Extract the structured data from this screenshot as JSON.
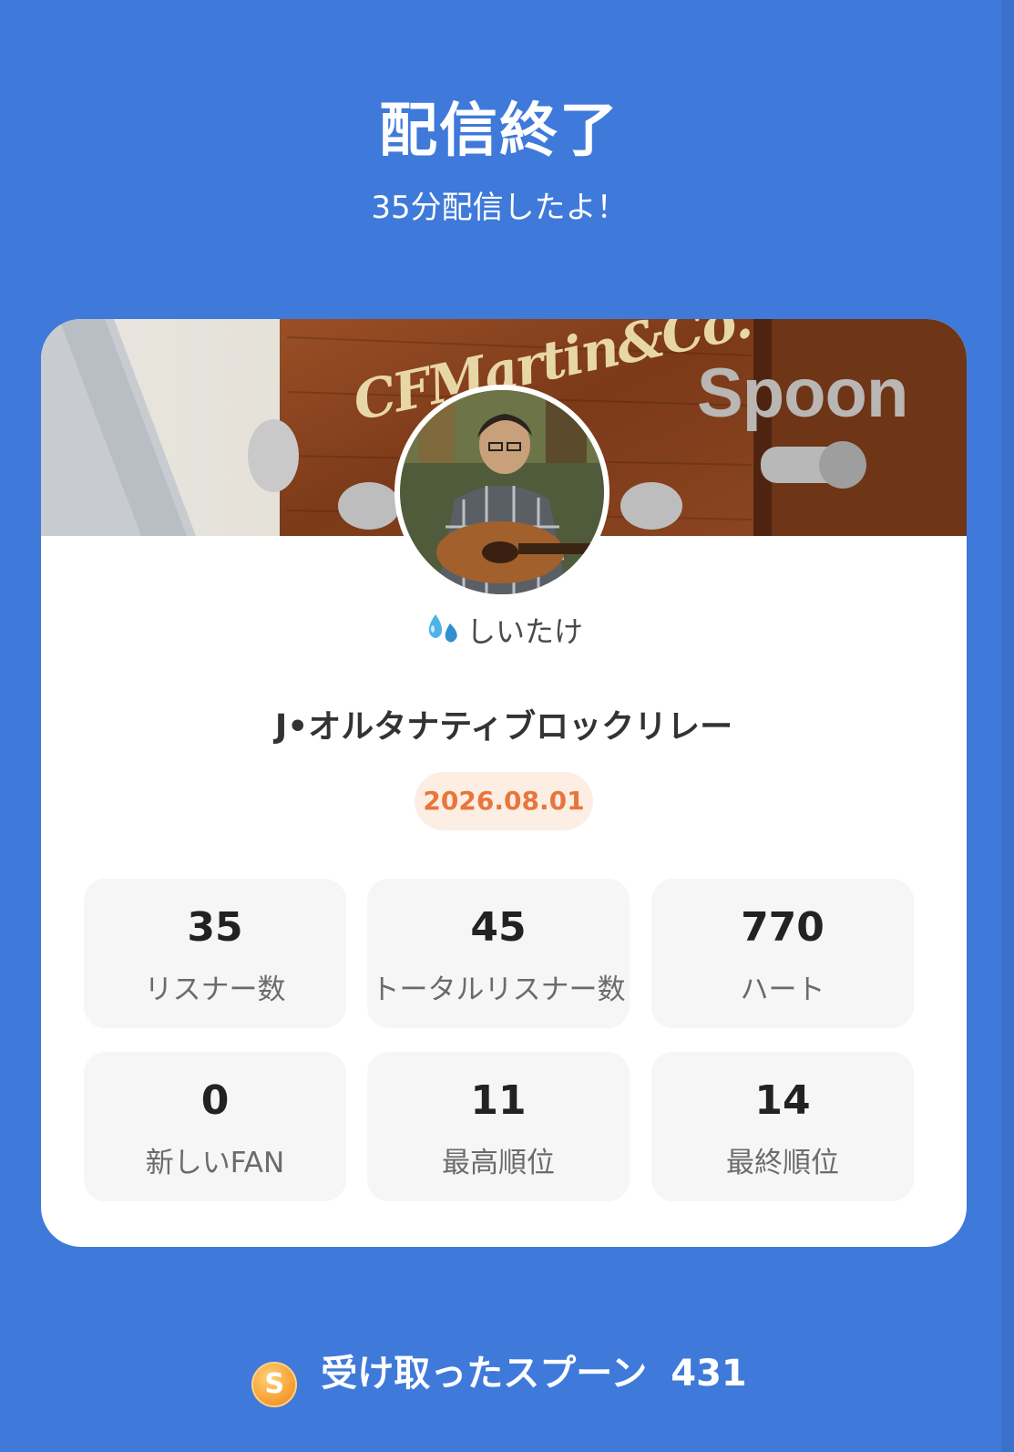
{
  "header": {
    "title": "配信終了",
    "subtitle": "35分配信したよ！"
  },
  "card": {
    "banner_watermark": "Spoon",
    "banner_brand_text": "CFMartin&Co.",
    "username": "しいたけ",
    "username_emoji": "sweat-droplets-icon",
    "live_title": "J•オルタナティブロックリレー",
    "date": "2026.08.01"
  },
  "stats": [
    {
      "value": "35",
      "label": "リスナー数"
    },
    {
      "value": "45",
      "label": "トータルリスナー数"
    },
    {
      "value": "770",
      "label": "ハート"
    },
    {
      "value": "0",
      "label": "新しいFAN"
    },
    {
      "value": "11",
      "label": "最高順位"
    },
    {
      "value": "14",
      "label": "最終順位"
    }
  ],
  "footer": {
    "coin_letter": "S",
    "spoons_label": "受け取ったスプーン",
    "spoons_count": "431"
  },
  "colors": {
    "background": "#3f79da",
    "date_text": "#e8763c",
    "date_bg": "#fdeee3",
    "stat_bg": "#f6f6f6"
  }
}
